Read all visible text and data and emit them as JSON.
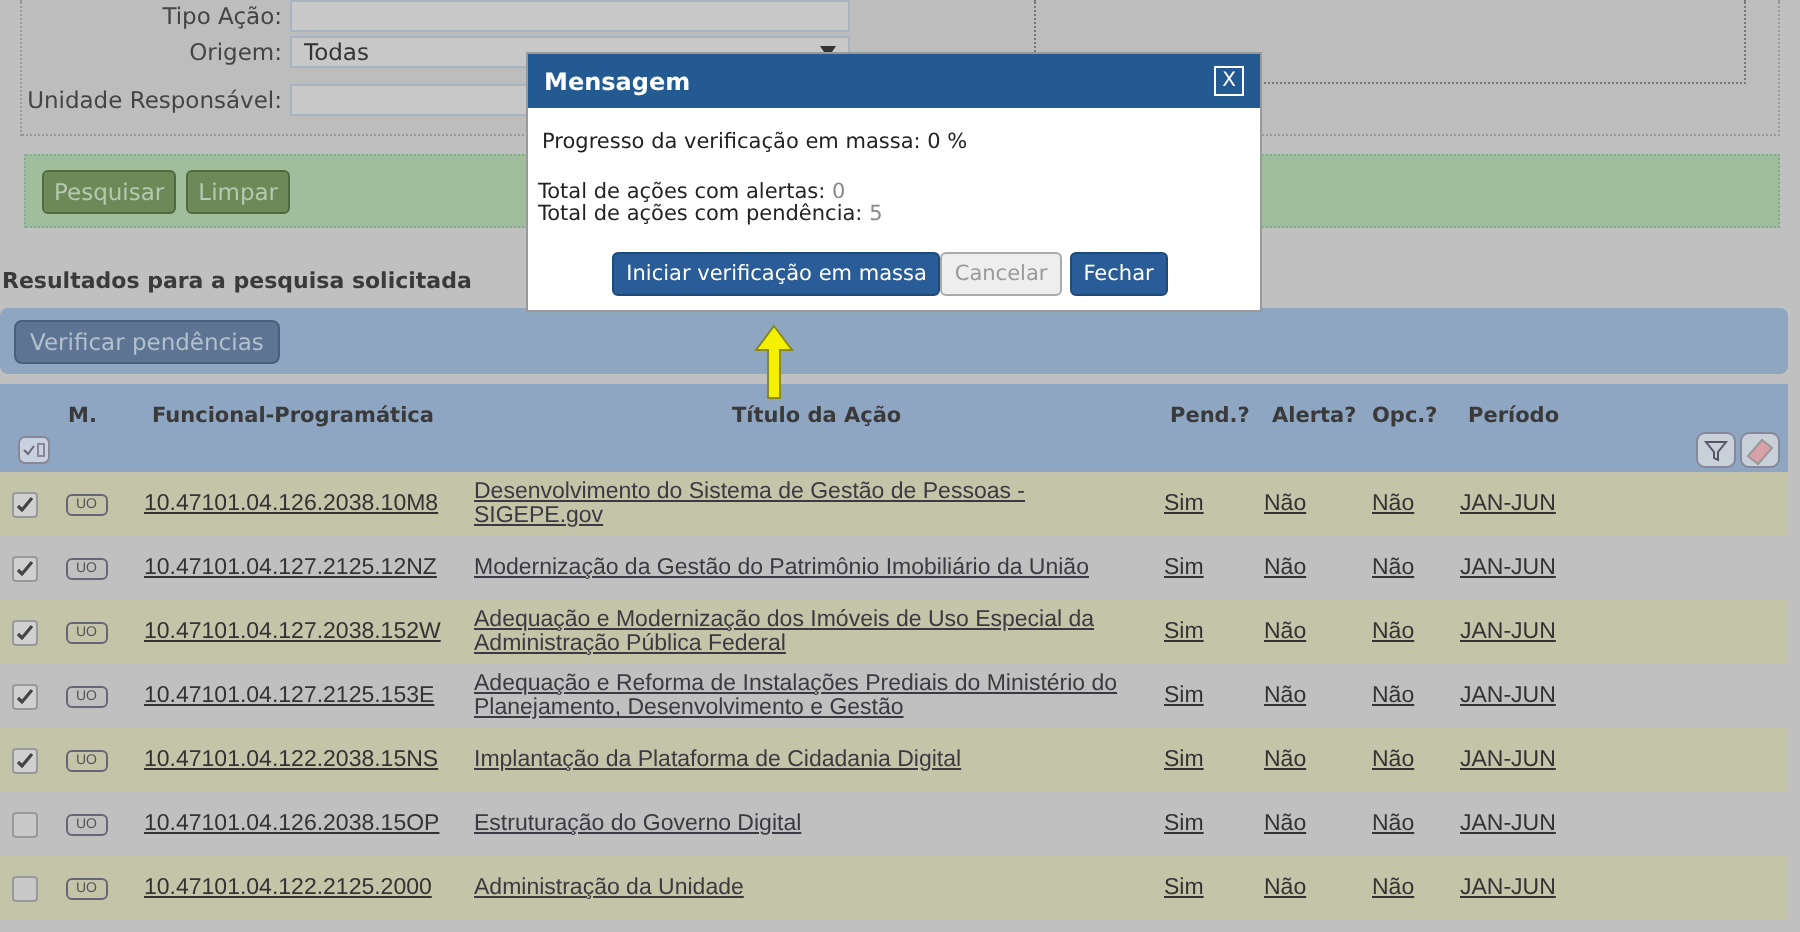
{
  "filters": [
    {
      "label": "Tipo Ação:",
      "kind": "text"
    },
    {
      "label": "Origem:",
      "kind": "select",
      "value": "Todas"
    },
    {
      "label": "Unidade Responsável:",
      "kind": "text"
    }
  ],
  "filter_buttons": [
    "Pesquisar",
    "Limpar"
  ],
  "results_title": "Resultados para a pesquisa solicitada",
  "toolbar_button": "Verificar pendências",
  "table": {
    "columns": [
      "M.",
      "Funcional-Programática",
      "Título da Ação",
      "Pend.?",
      "Alerta?",
      "Opc.?",
      "Período"
    ],
    "rows": [
      {
        "checked": true,
        "badge": "UO",
        "code": "10.47101.04.126.2038.10M8",
        "title": "Desenvolvimento do Sistema de Gestão de Pessoas - SIGEPE.gov",
        "pend": "Sim",
        "alerta": "Não",
        "opc": "Não",
        "periodo": "JAN-JUN"
      },
      {
        "checked": true,
        "badge": "UO",
        "code": "10.47101.04.127.2125.12NZ",
        "title": "Modernização da Gestão do Patrimônio Imobiliário da União",
        "pend": "Sim",
        "alerta": "Não",
        "opc": "Não",
        "periodo": "JAN-JUN"
      },
      {
        "checked": true,
        "badge": "UO",
        "code": "10.47101.04.127.2038.152W",
        "title": "Adequação e Modernização dos Imóveis de Uso Especial da Administração Pública Federal",
        "pend": "Sim",
        "alerta": "Não",
        "opc": "Não",
        "periodo": "JAN-JUN"
      },
      {
        "checked": true,
        "badge": "UO",
        "code": "10.47101.04.127.2125.153E",
        "title": "Adequação e Reforma de Instalações Prediais do Ministério do Planejamento, Desenvolvimento e Gestão",
        "pend": "Sim",
        "alerta": "Não",
        "opc": "Não",
        "periodo": "JAN-JUN"
      },
      {
        "checked": true,
        "badge": "UO",
        "code": "10.47101.04.122.2038.15NS",
        "title": "Implantação da Plataforma de Cidadania Digital",
        "pend": "Sim",
        "alerta": "Não",
        "opc": "Não",
        "periodo": "JAN-JUN"
      },
      {
        "checked": false,
        "badge": "UO",
        "code": "10.47101.04.126.2038.15OP",
        "title": "Estruturação do Governo Digital",
        "pend": "Sim",
        "alerta": "Não",
        "opc": "Não",
        "periodo": "JAN-JUN"
      },
      {
        "checked": false,
        "badge": "UO",
        "code": "10.47101.04.122.2125.2000",
        "title": "Administração da Unidade",
        "pend": "Sim",
        "alerta": "Não",
        "opc": "Não",
        "periodo": "JAN-JUN"
      }
    ]
  },
  "dialog": {
    "title": "Mensagem",
    "close": "X",
    "progress": {
      "label": "Progresso da verificação em massa:",
      "value": "0 %"
    },
    "totals": [
      {
        "label": "Total de ações com alertas:",
        "value": "0"
      },
      {
        "label": "Total de ações com pendência:",
        "value": "5"
      }
    ],
    "buttons": [
      {
        "label": "Iniciar verificação em massa",
        "kind": "primary"
      },
      {
        "label": "Cancelar",
        "kind": "disabled"
      },
      {
        "label": "Fechar",
        "kind": "primary"
      }
    ]
  }
}
